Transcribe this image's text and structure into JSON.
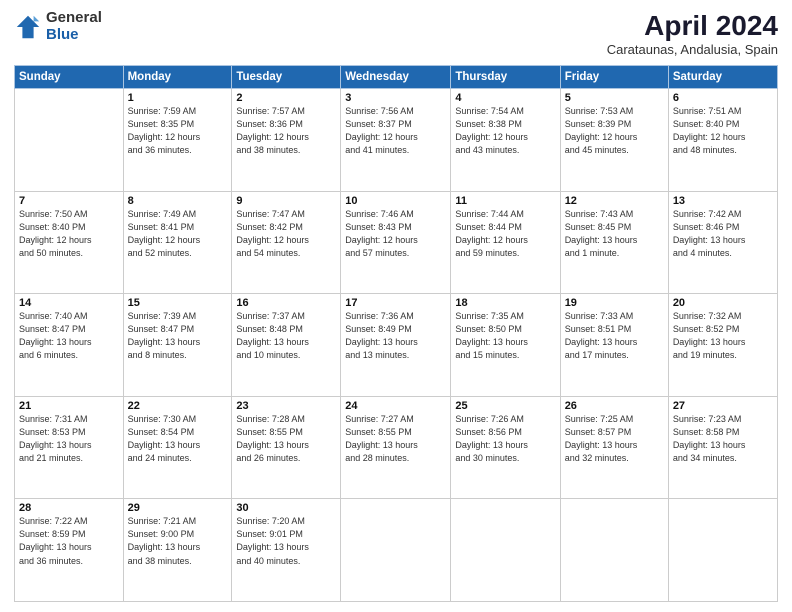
{
  "logo": {
    "general": "General",
    "blue": "Blue"
  },
  "title": "April 2024",
  "subtitle": "Carataunas, Andalusia, Spain",
  "headers": [
    "Sunday",
    "Monday",
    "Tuesday",
    "Wednesday",
    "Thursday",
    "Friday",
    "Saturday"
  ],
  "rows": [
    [
      {
        "day": "",
        "info": ""
      },
      {
        "day": "1",
        "info": "Sunrise: 7:59 AM\nSunset: 8:35 PM\nDaylight: 12 hours\nand 36 minutes."
      },
      {
        "day": "2",
        "info": "Sunrise: 7:57 AM\nSunset: 8:36 PM\nDaylight: 12 hours\nand 38 minutes."
      },
      {
        "day": "3",
        "info": "Sunrise: 7:56 AM\nSunset: 8:37 PM\nDaylight: 12 hours\nand 41 minutes."
      },
      {
        "day": "4",
        "info": "Sunrise: 7:54 AM\nSunset: 8:38 PM\nDaylight: 12 hours\nand 43 minutes."
      },
      {
        "day": "5",
        "info": "Sunrise: 7:53 AM\nSunset: 8:39 PM\nDaylight: 12 hours\nand 45 minutes."
      },
      {
        "day": "6",
        "info": "Sunrise: 7:51 AM\nSunset: 8:40 PM\nDaylight: 12 hours\nand 48 minutes."
      }
    ],
    [
      {
        "day": "7",
        "info": "Sunrise: 7:50 AM\nSunset: 8:40 PM\nDaylight: 12 hours\nand 50 minutes."
      },
      {
        "day": "8",
        "info": "Sunrise: 7:49 AM\nSunset: 8:41 PM\nDaylight: 12 hours\nand 52 minutes."
      },
      {
        "day": "9",
        "info": "Sunrise: 7:47 AM\nSunset: 8:42 PM\nDaylight: 12 hours\nand 54 minutes."
      },
      {
        "day": "10",
        "info": "Sunrise: 7:46 AM\nSunset: 8:43 PM\nDaylight: 12 hours\nand 57 minutes."
      },
      {
        "day": "11",
        "info": "Sunrise: 7:44 AM\nSunset: 8:44 PM\nDaylight: 12 hours\nand 59 minutes."
      },
      {
        "day": "12",
        "info": "Sunrise: 7:43 AM\nSunset: 8:45 PM\nDaylight: 13 hours\nand 1 minute."
      },
      {
        "day": "13",
        "info": "Sunrise: 7:42 AM\nSunset: 8:46 PM\nDaylight: 13 hours\nand 4 minutes."
      }
    ],
    [
      {
        "day": "14",
        "info": "Sunrise: 7:40 AM\nSunset: 8:47 PM\nDaylight: 13 hours\nand 6 minutes."
      },
      {
        "day": "15",
        "info": "Sunrise: 7:39 AM\nSunset: 8:47 PM\nDaylight: 13 hours\nand 8 minutes."
      },
      {
        "day": "16",
        "info": "Sunrise: 7:37 AM\nSunset: 8:48 PM\nDaylight: 13 hours\nand 10 minutes."
      },
      {
        "day": "17",
        "info": "Sunrise: 7:36 AM\nSunset: 8:49 PM\nDaylight: 13 hours\nand 13 minutes."
      },
      {
        "day": "18",
        "info": "Sunrise: 7:35 AM\nSunset: 8:50 PM\nDaylight: 13 hours\nand 15 minutes."
      },
      {
        "day": "19",
        "info": "Sunrise: 7:33 AM\nSunset: 8:51 PM\nDaylight: 13 hours\nand 17 minutes."
      },
      {
        "day": "20",
        "info": "Sunrise: 7:32 AM\nSunset: 8:52 PM\nDaylight: 13 hours\nand 19 minutes."
      }
    ],
    [
      {
        "day": "21",
        "info": "Sunrise: 7:31 AM\nSunset: 8:53 PM\nDaylight: 13 hours\nand 21 minutes."
      },
      {
        "day": "22",
        "info": "Sunrise: 7:30 AM\nSunset: 8:54 PM\nDaylight: 13 hours\nand 24 minutes."
      },
      {
        "day": "23",
        "info": "Sunrise: 7:28 AM\nSunset: 8:55 PM\nDaylight: 13 hours\nand 26 minutes."
      },
      {
        "day": "24",
        "info": "Sunrise: 7:27 AM\nSunset: 8:55 PM\nDaylight: 13 hours\nand 28 minutes."
      },
      {
        "day": "25",
        "info": "Sunrise: 7:26 AM\nSunset: 8:56 PM\nDaylight: 13 hours\nand 30 minutes."
      },
      {
        "day": "26",
        "info": "Sunrise: 7:25 AM\nSunset: 8:57 PM\nDaylight: 13 hours\nand 32 minutes."
      },
      {
        "day": "27",
        "info": "Sunrise: 7:23 AM\nSunset: 8:58 PM\nDaylight: 13 hours\nand 34 minutes."
      }
    ],
    [
      {
        "day": "28",
        "info": "Sunrise: 7:22 AM\nSunset: 8:59 PM\nDaylight: 13 hours\nand 36 minutes."
      },
      {
        "day": "29",
        "info": "Sunrise: 7:21 AM\nSunset: 9:00 PM\nDaylight: 13 hours\nand 38 minutes."
      },
      {
        "day": "30",
        "info": "Sunrise: 7:20 AM\nSunset: 9:01 PM\nDaylight: 13 hours\nand 40 minutes."
      },
      {
        "day": "",
        "info": ""
      },
      {
        "day": "",
        "info": ""
      },
      {
        "day": "",
        "info": ""
      },
      {
        "day": "",
        "info": ""
      }
    ]
  ]
}
